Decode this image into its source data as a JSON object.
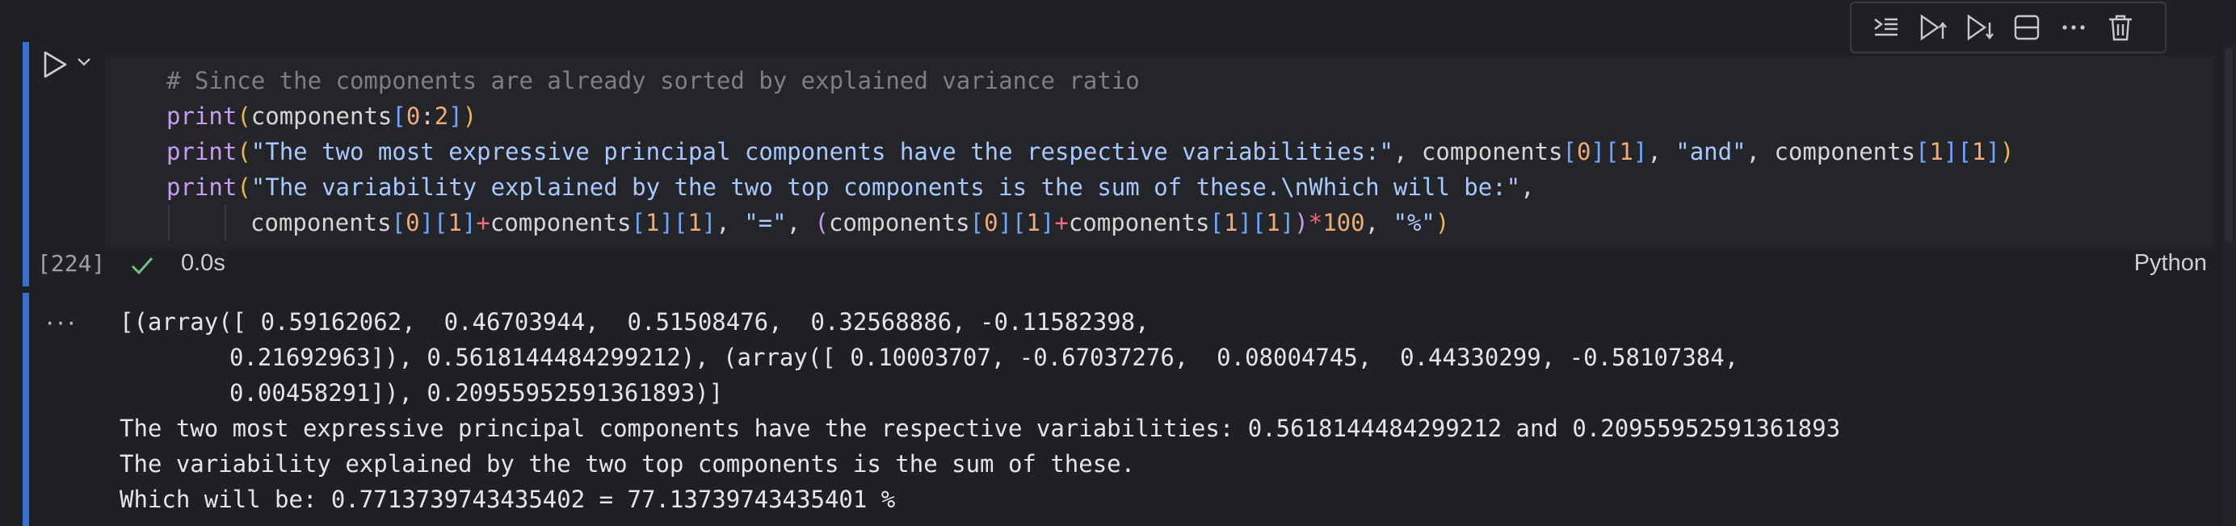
{
  "toolbar": {
    "icons": [
      "execute-above-cells-icon",
      "run-above-icon",
      "run-below-icon",
      "split-cell-icon",
      "more-actions-icon",
      "delete-cell-icon"
    ]
  },
  "cell": {
    "code": {
      "line1_comment": "# Since the components are already sorted by explained variance ratio",
      "line2": {
        "fn": "print",
        "a": "(",
        "b": "components",
        "c": "[",
        "d": "0",
        "e": ":",
        "f": "2",
        "g": "]",
        "h": ")"
      },
      "line3": {
        "fn": "print",
        "open": "(",
        "str1": "\"The two most expressive principal components have the respective variabilities:\"",
        "sep1": ", components",
        "i1": "0",
        "j1": "1",
        "sep2": ", ",
        "str2": "\"and\"",
        "sep3": ", components",
        "i2": "1",
        "j2": "1",
        "close": ")"
      },
      "line4": {
        "fn": "print",
        "open": "(",
        "str": "\"The variability explained by the two top components is the sum of these.\\nWhich will be:\"",
        "sep": ","
      },
      "line5": {
        "t1": "components",
        "i1": "0",
        "j1": "1",
        "plus1": "+",
        "t2": "components",
        "i2": "1",
        "j2": "1",
        "sep1": ", ",
        "eq": "\"=\"",
        "sep2": ", ",
        "t3": "components",
        "i3": "0",
        "j3": "1",
        "plus2": "+",
        "t4": "components",
        "i4": "1",
        "j4": "1",
        "times": "*",
        "hundred": "100",
        "sep3": ", ",
        "pct": "\"%\"",
        "close": ")"
      }
    },
    "execution_count": "[224]",
    "execution_time": "0.0s",
    "language": "Python"
  },
  "output": {
    "menu_label": "···",
    "lines": [
      "[(array([ 0.59162062,  0.46703944,  0.51508476,  0.32568886, -0.11582398,",
      "0.21692963]), 0.5618144484299212), (array([ 0.10003707, -0.67037276,  0.08004745,  0.44330299, -0.58107384,",
      "0.00458291]), 0.20955952591361893)]",
      "The two most expressive principal components have the respective variabilities: 0.5618144484299212 and 0.20955952591361893",
      "The variability explained by the two top components is the sum of these.",
      "Which will be: 0.7713739743435402 = 77.13739743435401 %"
    ]
  },
  "colors": {
    "accent": "#3b6fd1",
    "success": "#6cc28a",
    "background": "#1f2023"
  }
}
